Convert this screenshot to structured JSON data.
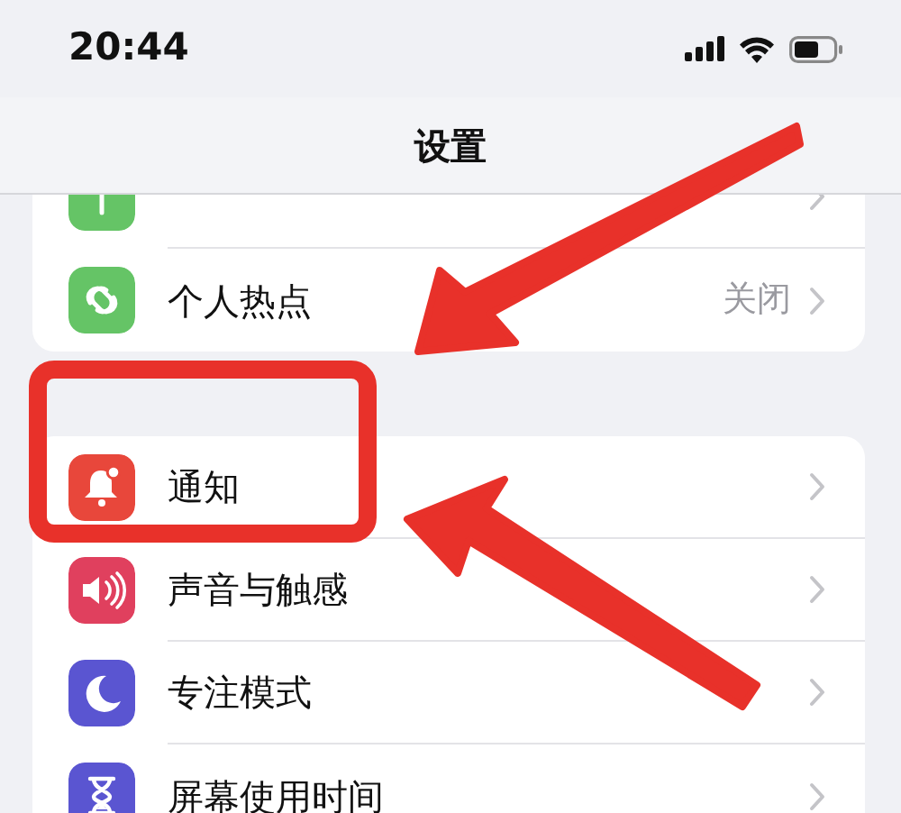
{
  "status_bar": {
    "time": "20:44"
  },
  "nav_bar": {
    "title": "设置"
  },
  "groups": [
    {
      "rows": [
        {
          "color": "#65c466"
        },
        {
          "label": "个人热点",
          "color": "#65c466",
          "value": "关闭"
        }
      ]
    },
    {
      "rows": [
        {
          "label": "通知",
          "color": "#e8473b"
        },
        {
          "label": "声音与触感",
          "color": "#e0405e"
        },
        {
          "label": "专注模式",
          "color": "#5a55d1"
        },
        {
          "label": "屏幕使用时间",
          "color": "#5a55d1"
        }
      ]
    }
  ],
  "annotations": [
    {
      "kind": "arrow",
      "color": "#e8312a"
    },
    {
      "kind": "box",
      "color": "#e8312a"
    },
    {
      "kind": "arrow",
      "color": "#e8312a"
    }
  ]
}
